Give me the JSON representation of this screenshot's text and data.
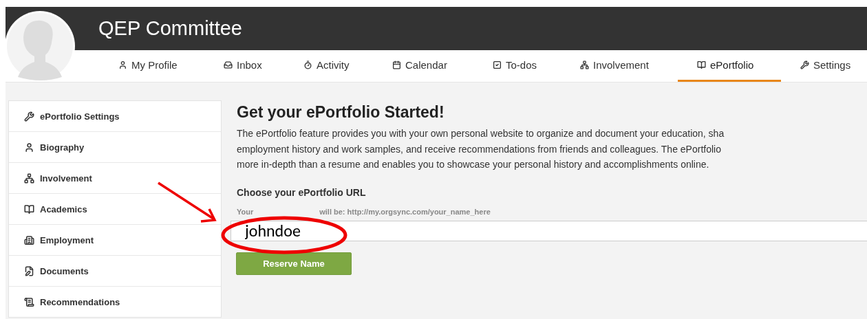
{
  "header": {
    "title": "QEP Committee"
  },
  "tabs": [
    {
      "label": "My Profile",
      "selected": false
    },
    {
      "label": "Inbox",
      "selected": false
    },
    {
      "label": "Activity",
      "selected": false
    },
    {
      "label": "Calendar",
      "selected": false
    },
    {
      "label": "To-dos",
      "selected": false
    },
    {
      "label": "Involvement",
      "selected": false
    },
    {
      "label": "ePortfolio",
      "selected": true
    },
    {
      "label": "Settings",
      "selected": false
    }
  ],
  "sidebar": {
    "items": [
      {
        "label": "ePortfolio Settings"
      },
      {
        "label": "Biography"
      },
      {
        "label": "Involvement"
      },
      {
        "label": "Academics"
      },
      {
        "label": "Employment"
      },
      {
        "label": "Documents"
      },
      {
        "label": "Recommendations"
      }
    ]
  },
  "content": {
    "heading": "Get your ePortfolio Started!",
    "paragraph_lines": [
      "The ePortfolio feature provides you with your own personal website to organize and document your education, sha",
      "employment history and work samples, and receive recommendations from friends and colleagues. The ePortfolio",
      "more in-depth than a resume and enables you to showcase your personal history and accomplishments online."
    ],
    "url_label": "Choose your ePortfolio URL",
    "url_hint_parts": [
      "Your",
      "will be: http://my.orgsync.com/your_name_here"
    ],
    "url_value": "johndoe",
    "button": "Reserve Name"
  }
}
